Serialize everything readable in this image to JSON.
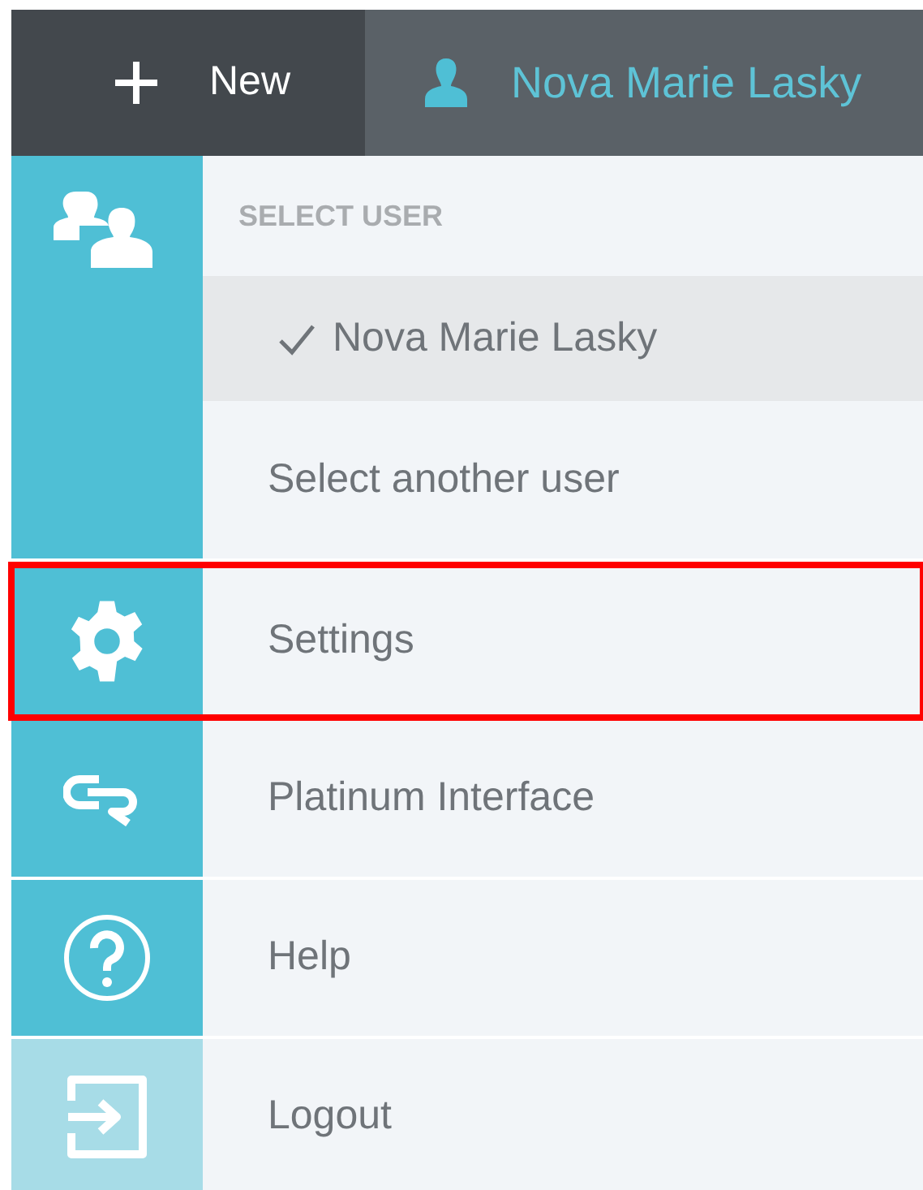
{
  "top_bar": {
    "new_button": {
      "label": "New"
    },
    "current_user": {
      "label": "Nova Marie Lasky"
    }
  },
  "user_section": {
    "header": "SELECT USER",
    "items": [
      {
        "label": "Nova Marie Lasky",
        "selected": true
      },
      {
        "label": "Select another user",
        "selected": false
      }
    ]
  },
  "menu_items": [
    {
      "kind": "gear",
      "label": "Settings",
      "highlighted": true
    },
    {
      "kind": "logo",
      "label": "Platinum Interface",
      "highlighted": false
    },
    {
      "kind": "help",
      "label": "Help",
      "highlighted": false
    },
    {
      "kind": "logout",
      "label": "Logout",
      "highlighted": false
    }
  ]
}
